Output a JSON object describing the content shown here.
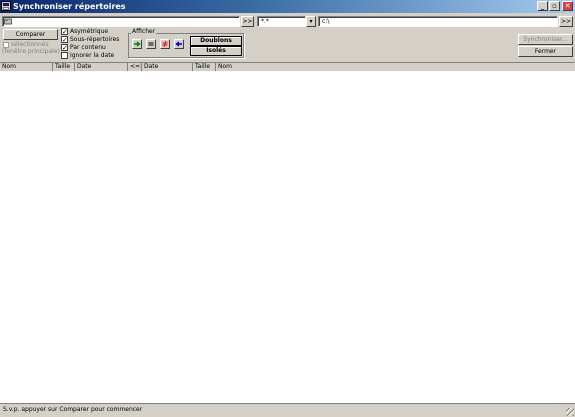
{
  "window": {
    "title": "Synchroniser répertoires",
    "minimize_glyph": "_",
    "maximize_glyph": "▫",
    "close_glyph": "✕"
  },
  "paths": {
    "left_path": "",
    "left_browse_label": ">>",
    "filter_value": "*.*",
    "right_path": "c:\\",
    "right_browse_label": ">>"
  },
  "actions": {
    "compare_label": "Comparer",
    "selected_label": "sélectionnés",
    "main_window_label": "(fenêtre principale)",
    "synchronize_label": "Synchroniser...",
    "close_label": "Fermer"
  },
  "options": {
    "asymmetric": {
      "label": "Asymétrique",
      "checked": true
    },
    "subdirs": {
      "label": "Sous-répertoires",
      "checked": true
    },
    "by_content": {
      "label": "Par contenu",
      "checked": true
    },
    "ignore_date": {
      "label": "Ignorer la date",
      "checked": false
    }
  },
  "show_group": {
    "label": "Afficher",
    "doubles_label": "Doublons",
    "singles_label": "Isolés",
    "icons": [
      "right-arrow-icon",
      "equals-icon",
      "not-equal-icon",
      "left-arrow-icon"
    ],
    "colors": {
      "right": "#008000",
      "equal": "#000000",
      "notequal": "#ff0000",
      "left": "#0000c0"
    }
  },
  "columns": {
    "left_name": "Nom",
    "left_size": "Taille",
    "left_date": "Date",
    "compare": "<=>",
    "right_date": "Date",
    "right_size": "Taille",
    "right_name": "Nom"
  },
  "status": {
    "message": "S.v.p. appuyer sur Comparer pour commencer"
  }
}
